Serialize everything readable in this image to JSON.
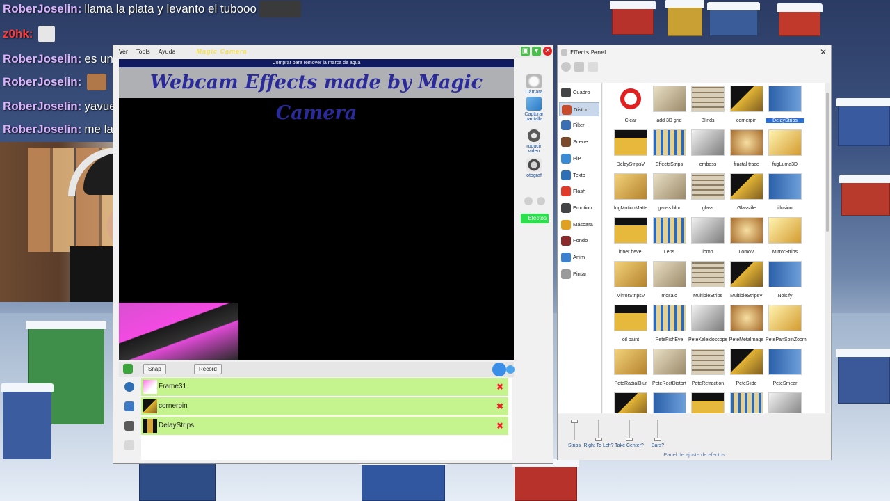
{
  "chat": [
    {
      "user": "RoberJoselin:",
      "message": "llama la plata y levanto el tubooo"
    },
    {
      "user": "z0hk:",
      "message": ""
    },
    {
      "user": "RoberJoselin:",
      "message": "es un album"
    },
    {
      "user": "RoberJoselin:",
      "message": ""
    },
    {
      "user": "RoberJoselin:",
      "message": "yavuelvo"
    },
    {
      "user": "RoberJoselin:",
      "message": "me lavare los dientes"
    }
  ],
  "magic_camera": {
    "menu": [
      "Ver",
      "Tools",
      "Ayuda"
    ],
    "logo": "Magic Camera",
    "watermark_bar": "Comprar para remover la marca de agua",
    "banner": "Webcam Effects made by Magic Camera",
    "side_tools": [
      "Cámara",
      "Capturar pantalla",
      "roducir video",
      "otograf"
    ],
    "efectos_label": "Efectos",
    "snap_label": "Snap",
    "record_label": "Record",
    "layers": [
      "Frame31",
      "cornerpin",
      "DelayStrips"
    ]
  },
  "effects_panel": {
    "title": "Effects Panel",
    "categories": [
      "Cuadro",
      "Distort",
      "Filter",
      "Scene",
      "PiP",
      "Texto",
      "Flash",
      "Emotion",
      "Máscara",
      "Fondo",
      "Anim",
      "Pintar"
    ],
    "active_category": "Distort",
    "effects": [
      "Clear",
      "add 3D grid",
      "Blinds",
      "cornerpin",
      "DelayStrips",
      "DelayStripsV",
      "EffectsStrips",
      "emboss",
      "fractal trace",
      "fugLuma3D",
      "fugMotionMatte",
      "gauss blur",
      "glass",
      "Glasstile",
      "illusion",
      "inner bevel",
      "Lens",
      "lomo",
      "LomoV",
      "MirrorStrips",
      "MirrorStripsV",
      "mosaic",
      "MultipleStrips",
      "MultipleStripsV",
      "Noisify",
      "oil paint",
      "PeteFishEye",
      "PeteKaleidoscope",
      "PeteMetaImage",
      "PetePanSpinZoom",
      "PeteRadialBlur",
      "PeteRectDistort",
      "PeteRefraction",
      "PeteSlide",
      "PeteSmear"
    ],
    "selected_effect": "DelayStrips",
    "sliders": [
      "Strips",
      "Right To Left?",
      "Take Center?",
      "Bars?"
    ],
    "footer": "Panel de ajuste de efectos"
  },
  "colors": {
    "chat_user": "#d9b3ff",
    "layer_row": "#c5f48e",
    "selection": "#2a6fd1",
    "efectos_badge": "#2ae04b"
  }
}
